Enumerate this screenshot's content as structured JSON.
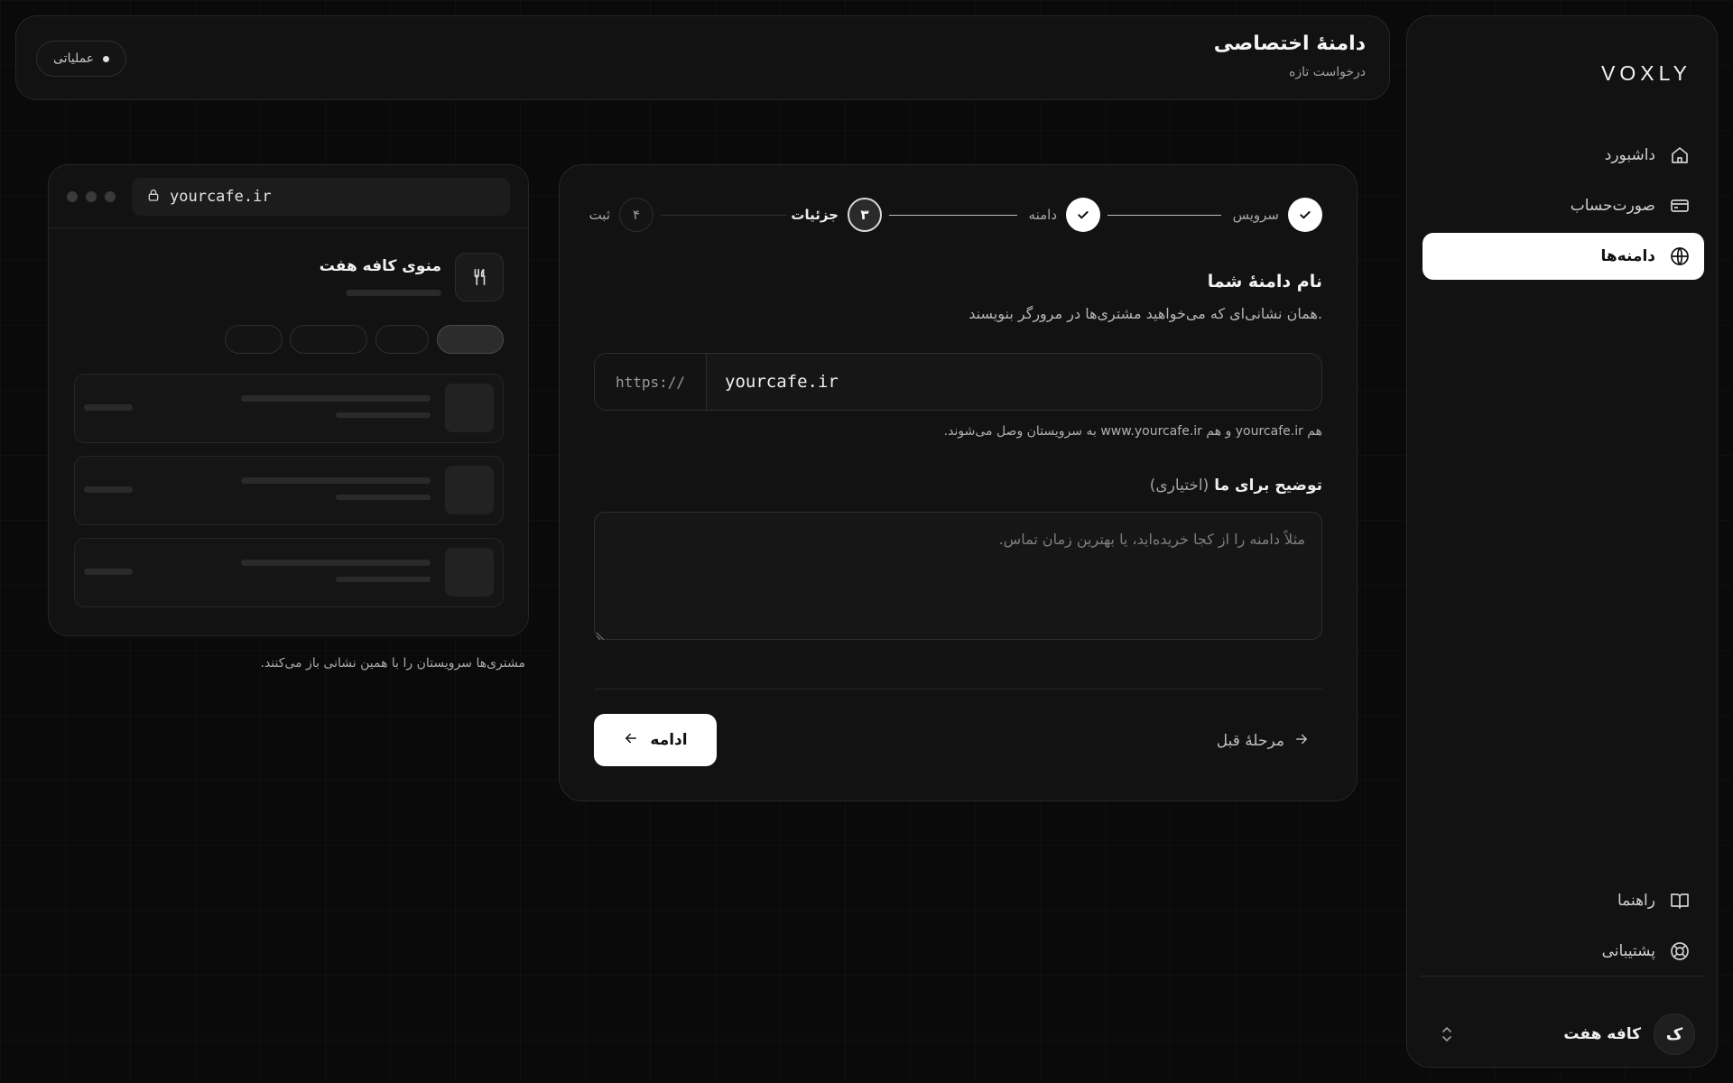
{
  "sidebar": {
    "brand": "VOXLY",
    "nav": [
      {
        "label": "داشبورد",
        "icon": "home-icon"
      },
      {
        "label": "صورت‌حساب",
        "icon": "credit-card-icon"
      },
      {
        "label": "دامنه‌ها",
        "icon": "globe-icon",
        "active": true
      }
    ],
    "footer_nav": [
      {
        "label": "راهنما",
        "icon": "book-icon"
      },
      {
        "label": "پشتیبانی",
        "icon": "life-buoy-icon"
      }
    ],
    "account": {
      "name": "کافه هفت",
      "initial": "ک"
    }
  },
  "header": {
    "title": "دامنهٔ اختصاصی",
    "subtitle": "درخواست تازه",
    "status": "عملیاتی"
  },
  "stepper": {
    "steps": [
      {
        "label": "سرویس",
        "state": "done"
      },
      {
        "label": "دامنه",
        "state": "done"
      },
      {
        "label": "جزئیات",
        "number": "۳",
        "state": "current"
      },
      {
        "label": "ثبت",
        "number": "۴",
        "state": "todo"
      }
    ]
  },
  "form": {
    "section_title": "نام دامنهٔ شما",
    "section_desc": "همان نشانی‌ای که می‌خواهید مشتری‌ها در مرورگر بنویسند.",
    "prefix": "https://",
    "domain_value": "yourcafe.ir",
    "domain_hint": "هم yourcafe.ir و هم www.yourcafe.ir به سرویستان وصل می‌شوند.",
    "notes_label": "توضیح برای ما",
    "notes_optional": "(اختیاری)",
    "notes_placeholder": "مثلاً دامنه را از کجا خریده‌اید، یا بهترین زمان تماس.",
    "continue_label": "ادامه",
    "back_label": "مرحلهٔ قبل"
  },
  "preview": {
    "url": "yourcafe.ir",
    "menu_title": "منوی کافه هفت",
    "caption": "مشتری‌ها سرویستان را با همین نشانی باز می‌کنند."
  },
  "colors": {
    "background": "#0a0a0a",
    "panel": "#121212",
    "border": "#262626",
    "accent": "#ffffff"
  }
}
